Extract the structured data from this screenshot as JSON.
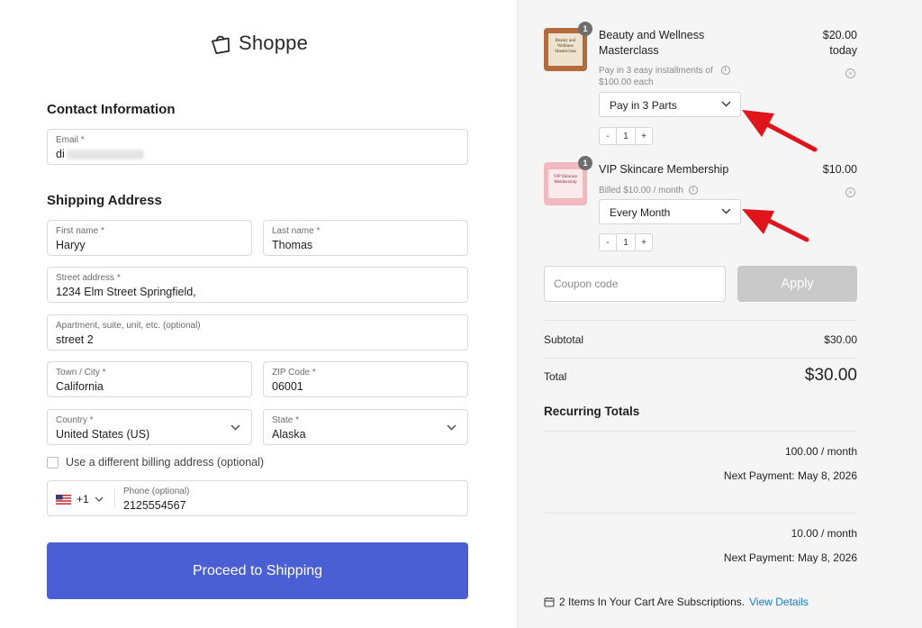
{
  "brand": {
    "name": "Shoppe"
  },
  "contact": {
    "title": "Contact Information",
    "email_label": "Email *",
    "email_value": "di"
  },
  "shipping": {
    "title": "Shipping Address",
    "first_name_label": "First name *",
    "first_name_value": "Haryy",
    "last_name_label": "Last name *",
    "last_name_value": "Thomas",
    "street_label": "Street address *",
    "street_value": "1234 Elm Street Springfield,",
    "apartment_label": "Apartment, suite, unit, etc. (optional)",
    "apartment_value": "street 2",
    "city_label": "Town / City *",
    "city_value": "California",
    "zip_label": "ZIP Code *",
    "zip_value": "06001",
    "country_label": "Country *",
    "country_value": "United States (US)",
    "state_label": "State *",
    "state_value": "Alaska",
    "billing_checkbox_label": "Use a different billing address (optional)",
    "phone_code": "+1",
    "phone_label": "Phone (optional)",
    "phone_value": "2125554567"
  },
  "proceed_button": "Proceed to Shipping",
  "cart": {
    "items": [
      {
        "badge": "1",
        "thumb_text": "Beauty and Wellness Masterclass",
        "name_line1": "Beauty and Wellness",
        "name_line2": "Masterclass",
        "price": "$20.00",
        "price_note": "today",
        "note_line1": "Pay in 3 easy installments of",
        "note_line2": "$100.00 each",
        "plan": "Pay in 3 Parts",
        "qty": "1"
      },
      {
        "badge": "1",
        "thumb_text": "VIP Skincare Membership",
        "name_line1": "VIP Skincare Membership",
        "price": "$10.00",
        "note_line1": "Billed $10.00 / month",
        "plan": "Every Month",
        "qty": "1"
      }
    ],
    "stepper_minus": "-",
    "stepper_plus": "+",
    "remove_symbol": "×",
    "info_symbol": "i",
    "coupon_placeholder": "Coupon code",
    "apply_label": "Apply",
    "subtotal_label": "Subtotal",
    "subtotal_value": "$30.00",
    "total_label": "Total",
    "total_value": "$30.00",
    "recurring_title": "Recurring Totals",
    "recurring": [
      {
        "amount": "100.00 / month",
        "next": "Next Payment: May 8, 2026"
      },
      {
        "amount": "10.00 / month",
        "next": "Next Payment: May 8, 2026"
      }
    ],
    "subscription_note": "2 Items In Your Cart Are Subscriptions.",
    "view_details": "View Details"
  },
  "colors": {
    "primary_button": "#4a5fd3",
    "apply_disabled": "#c9c9c9",
    "annotation_arrow": "#e0141b",
    "link": "#1a7bc9",
    "right_panel_bg": "#f5f5f5"
  },
  "icons": [
    "shopping-bag-icon",
    "chevron-down-icon",
    "info-icon",
    "remove-icon",
    "us-flag-icon",
    "calendar-icon",
    "red-arrow-annotation"
  ]
}
